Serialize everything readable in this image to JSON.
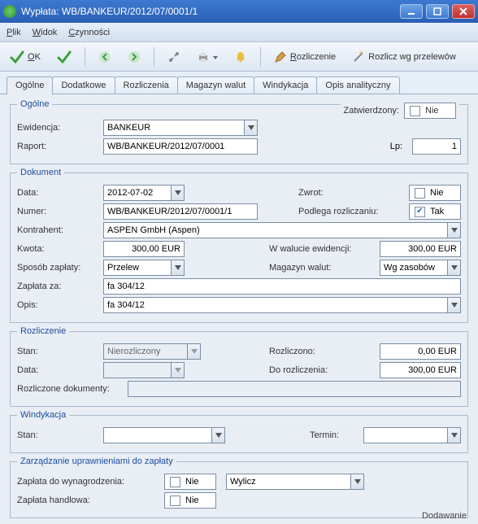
{
  "window": {
    "title": "Wypłata: WB/BANKEUR/2012/07/0001/1"
  },
  "menu": {
    "plik": "Plik",
    "widok": "Widok",
    "czynnosci": "Czynności"
  },
  "toolbar": {
    "ok_label": "OK",
    "rozliczenie_label": "Rozliczenie",
    "rozlicz_wg_label": "Rozlicz wg przelewów"
  },
  "tabs": {
    "ogolne": "Ogólne",
    "dodatkowe": "Dodatkowe",
    "rozliczenia": "Rozliczenia",
    "magazyn_walut": "Magazyn walut",
    "windykacja": "Windykacja",
    "opis_analityczny": "Opis analityczny"
  },
  "section_ogolne": {
    "legend": "Ogólne",
    "zatwierdzony_label": "Zatwierdzony:",
    "zatwierdzony_value": "Nie",
    "zatwierdzony_checked": false,
    "ewidencja_label": "Ewidencja:",
    "ewidencja_value": "BANKEUR",
    "raport_label": "Raport:",
    "raport_value": "WB/BANKEUR/2012/07/0001",
    "lp_label": "Lp:",
    "lp_value": "1"
  },
  "section_dokument": {
    "legend": "Dokument",
    "data_label": "Data:",
    "data_value": "2012-07-02",
    "zwrot_label": "Zwrot:",
    "zwrot_value": "Nie",
    "zwrot_checked": false,
    "numer_label": "Numer:",
    "numer_value": "WB/BANKEUR/2012/07/0001/1",
    "podlega_label": "Podlega rozliczaniu:",
    "podlega_value": "Tak",
    "podlega_checked": true,
    "kontrahent_label": "Kontrahent:",
    "kontrahent_value": "ASPEN GmbH (Aspen)",
    "kwota_label": "Kwota:",
    "kwota_value": "300,00 EUR",
    "w_walucie_label": "W walucie ewidencji:",
    "w_walucie_value": "300,00 EUR",
    "sposob_label": "Sposób zapłaty:",
    "sposob_value": "Przelew",
    "magazyn_label": "Magazyn walut:",
    "magazyn_value": "Wg zasobów",
    "zaplata_za_label": "Zapłata za:",
    "zaplata_za_value": "fa 304/12",
    "opis_label": "Opis:",
    "opis_value": "fa 304/12"
  },
  "section_rozliczenie": {
    "legend": "Rozliczenie",
    "stan_label": "Stan:",
    "stan_value": "Nierozliczony",
    "rozliczono_label": "Rozliczono:",
    "rozliczono_value": "0,00 EUR",
    "data_label": "Data:",
    "data_value": "",
    "do_rozliczenia_label": "Do rozliczenia:",
    "do_rozliczenia_value": "300,00 EUR",
    "rozliczone_doc_label": "Rozliczone dokumenty:",
    "rozliczone_doc_value": ""
  },
  "section_windykacja": {
    "legend": "Windykacja",
    "stan_label": "Stan:",
    "stan_value": "",
    "termin_label": "Termin:",
    "termin_value": ""
  },
  "section_zarzadzanie": {
    "legend": "Zarządzanie uprawnieniami do zapłaty",
    "zaplata_wyn_label": "Zapłata do wynagrodzenia:",
    "zaplata_wyn_value": "Nie",
    "zaplata_wyn_checked": false,
    "wylicz_value": "Wylicz",
    "zaplata_handlowa_label": "Zapłata handlowa:",
    "zaplata_handlowa_value": "Nie",
    "zaplata_handlowa_checked": false
  },
  "footer": {
    "status": "Dodawanie"
  }
}
